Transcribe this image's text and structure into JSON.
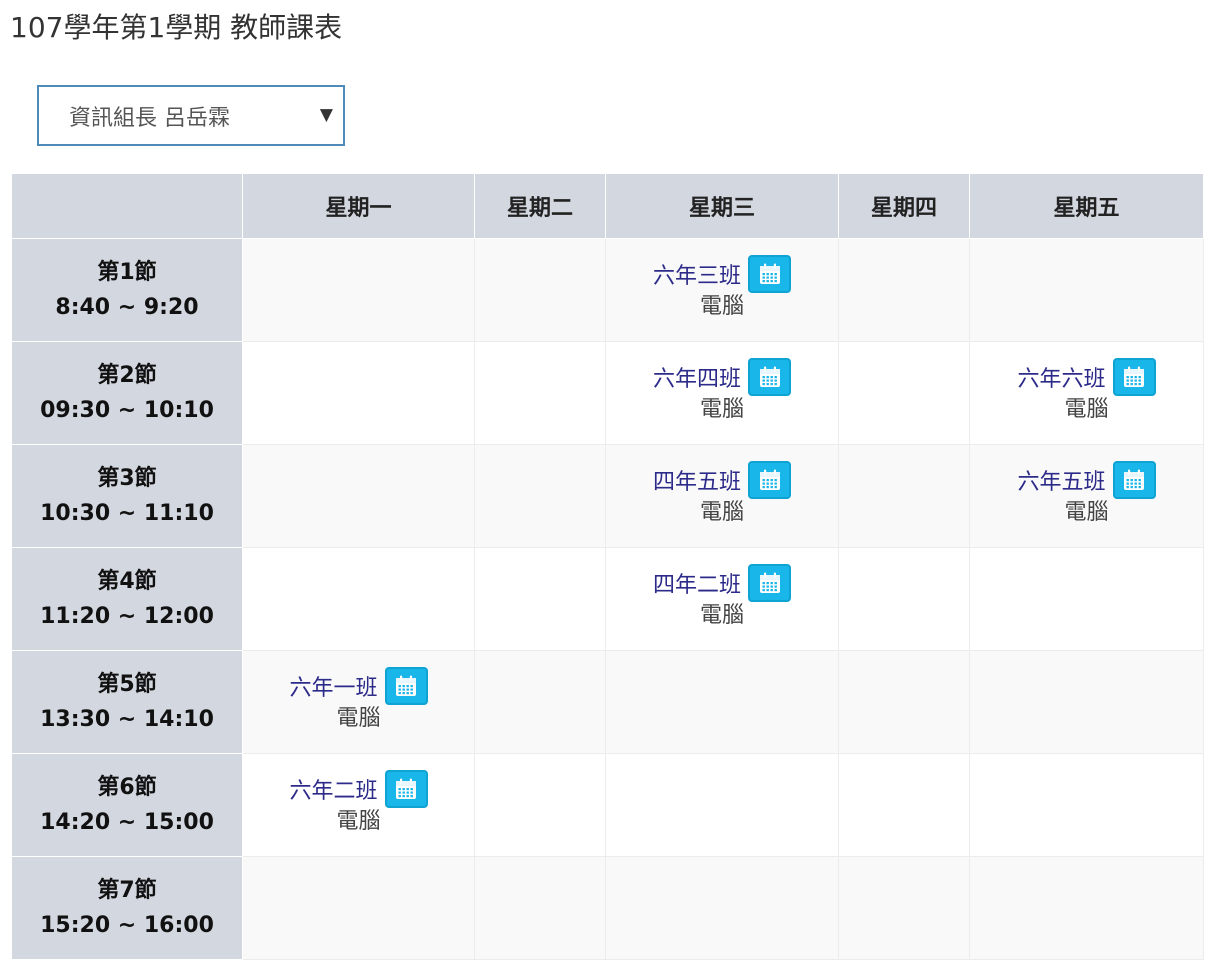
{
  "page": {
    "title": "107學年第1學期 教師課表"
  },
  "teacher_select": {
    "value": "資訊組長 呂岳霖",
    "arrow": "▼"
  },
  "colors": {
    "accent": "#19b6ea",
    "header_bg": "#d3d7df",
    "class_link": "#2d2b8a"
  },
  "icons": {
    "schedule_button": "calendar-icon"
  },
  "schedule": {
    "days": [
      "星期一",
      "星期二",
      "星期三",
      "星期四",
      "星期五"
    ],
    "periods": [
      {
        "name": "第1節",
        "time": "8:40 ~ 9:20",
        "cells": [
          null,
          null,
          {
            "class": "六年三班",
            "subject": "電腦"
          },
          null,
          null
        ]
      },
      {
        "name": "第2節",
        "time": "09:30 ~ 10:10",
        "cells": [
          null,
          null,
          {
            "class": "六年四班",
            "subject": "電腦"
          },
          null,
          {
            "class": "六年六班",
            "subject": "電腦"
          }
        ]
      },
      {
        "name": "第3節",
        "time": "10:30 ~ 11:10",
        "cells": [
          null,
          null,
          {
            "class": "四年五班",
            "subject": "電腦"
          },
          null,
          {
            "class": "六年五班",
            "subject": "電腦"
          }
        ]
      },
      {
        "name": "第4節",
        "time": "11:20 ~ 12:00",
        "cells": [
          null,
          null,
          {
            "class": "四年二班",
            "subject": "電腦"
          },
          null,
          null
        ]
      },
      {
        "name": "第5節",
        "time": "13:30 ~ 14:10",
        "cells": [
          {
            "class": "六年一班",
            "subject": "電腦"
          },
          null,
          null,
          null,
          null
        ]
      },
      {
        "name": "第6節",
        "time": "14:20 ~ 15:00",
        "cells": [
          {
            "class": "六年二班",
            "subject": "電腦"
          },
          null,
          null,
          null,
          null
        ]
      },
      {
        "name": "第7節",
        "time": "15:20 ~ 16:00",
        "cells": [
          null,
          null,
          null,
          null,
          null
        ]
      }
    ]
  }
}
